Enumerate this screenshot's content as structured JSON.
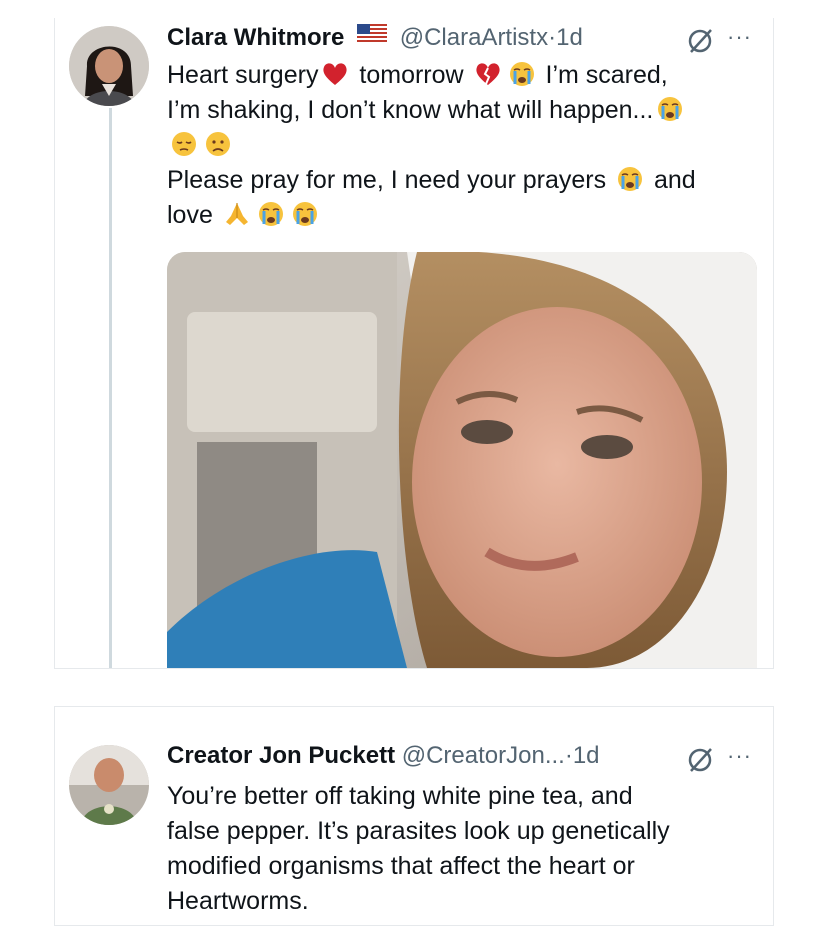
{
  "tweet1": {
    "author_name": "Clara Whitmore",
    "author_handle": "@ClaraArtistx",
    "separator": "·",
    "time": "1d",
    "flag_icon": "us-flag-icon",
    "text": {
      "l1_a": "Heart surgery",
      "l1_b": " tomorrow ",
      "l1_c": " I’m scared,",
      "l2": "I’m shaking, I don’t know what will happen...",
      "l4": "Please pray for me, I need your prayers ",
      "l4_b": " and",
      "l5": "love "
    },
    "media_alt_icon": "hospital-selfie-photo"
  },
  "tweet2": {
    "author_name": "Creator Jon Puckett",
    "author_handle": "@CreatorJon...",
    "separator": "·",
    "time": "1d",
    "text": {
      "l1": "You’re better off taking white pine tea, and",
      "l2": "false pepper. It’s parasites look up genetically",
      "l3": "modified organisms that affect the heart or",
      "l4": "Heartworms."
    }
  },
  "icons": {
    "grok": "grok-icon",
    "more": "more-icon",
    "more_glyph": "···"
  },
  "colors": {
    "text": "#0f1419",
    "secondary": "#536471",
    "border": "#e6e9ec",
    "thread_line": "#cfd9de"
  }
}
